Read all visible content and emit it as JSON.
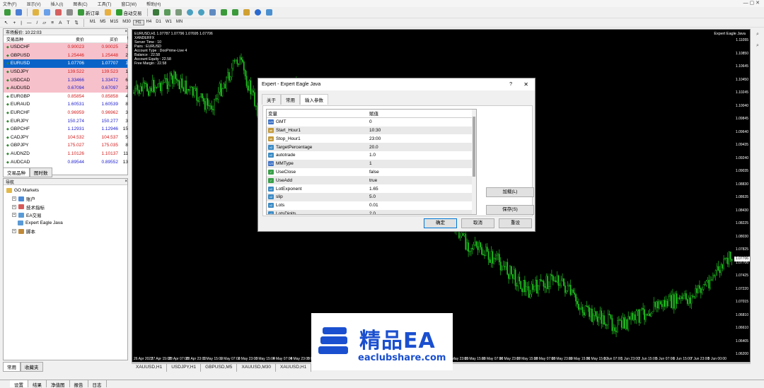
{
  "menu": [
    "文件(F)",
    "显示(V)",
    "插入(I)",
    "图表(C)",
    "工具(T)",
    "窗口(W)",
    "帮助(H)"
  ],
  "toolbar": {
    "new_order": "新订单",
    "auto_trade": "自动交易",
    "timeframes": [
      "M1",
      "M5",
      "M15",
      "M30",
      "H1",
      "H4",
      "D1",
      "W1",
      "MN"
    ],
    "active_timeframe": "H1"
  },
  "market_watch": {
    "title": "市场报价: 10:22:03",
    "col_symbol": "交易品种",
    "col_bid": "卖价",
    "col_ask": "买价",
    "col_spread": "!",
    "rows": [
      {
        "symbol": "USDCHF",
        "bid": "0.90023",
        "ask": "0.90025",
        "spread": "2",
        "style": "pink",
        "dir": "dn"
      },
      {
        "symbol": "GBPUSD",
        "bid": "1.25446",
        "ask": "1.25448",
        "spread": "2",
        "style": "pink",
        "dir": "dn"
      },
      {
        "symbol": "EURUSD",
        "bid": "1.07706",
        "ask": "1.07707",
        "spread": "1",
        "style": "sel",
        "dir": "up"
      },
      {
        "symbol": "USDJPY",
        "bid": "139.522",
        "ask": "139.523",
        "spread": "1",
        "style": "pink",
        "dir": "dn"
      },
      {
        "symbol": "USDCAD",
        "bid": "1.33466",
        "ask": "1.33472",
        "spread": "6",
        "style": "pink",
        "dir": "up"
      },
      {
        "symbol": "AUDUSD",
        "bid": "0.67094",
        "ask": "0.67097",
        "spread": "3",
        "style": "pink",
        "dir": "up"
      },
      {
        "symbol": "EURGBP",
        "bid": "0.85854",
        "ask": "0.85858",
        "spread": "4",
        "style": "",
        "dir": "dn"
      },
      {
        "symbol": "EURAUD",
        "bid": "1.60531",
        "ask": "1.60539",
        "spread": "8",
        "style": "",
        "dir": "up"
      },
      {
        "symbol": "EURCHF",
        "bid": "0.96959",
        "ask": "0.96962",
        "spread": "3",
        "style": "",
        "dir": "dn"
      },
      {
        "symbol": "EURJPY",
        "bid": "150.274",
        "ask": "150.277",
        "spread": "3",
        "style": "",
        "dir": "up"
      },
      {
        "symbol": "GBPCHF",
        "bid": "1.12931",
        "ask": "1.12946",
        "spread": "15",
        "style": "",
        "dir": "up"
      },
      {
        "symbol": "CADJPY",
        "bid": "104.532",
        "ask": "104.537",
        "spread": "5",
        "style": "",
        "dir": "dn"
      },
      {
        "symbol": "GBPJPY",
        "bid": "175.027",
        "ask": "175.035",
        "spread": "8",
        "style": "",
        "dir": "dn"
      },
      {
        "symbol": "AUDNZD",
        "bid": "1.10126",
        "ask": "1.10137",
        "spread": "11",
        "style": "",
        "dir": "dn"
      },
      {
        "symbol": "AUDCAD",
        "bid": "0.89544",
        "ask": "0.89552",
        "spread": "13",
        "style": "",
        "dir": "up"
      }
    ],
    "tabs": [
      "交易品种",
      "图时数"
    ]
  },
  "navigator": {
    "title": "导航",
    "items": [
      {
        "label": "GO Markets",
        "level": 0,
        "icon": "folder-icon"
      },
      {
        "label": "账户",
        "level": 1,
        "icon": "account-icon"
      },
      {
        "label": "技术指标",
        "level": 1,
        "icon": "indicator-icon"
      },
      {
        "label": "EA交易",
        "level": 1,
        "icon": "expert-icon"
      },
      {
        "label": "Expert Eagle Java",
        "level": 2,
        "icon": "expert-icon"
      },
      {
        "label": "脚本",
        "level": 1,
        "icon": "script-icon"
      }
    ],
    "tabs": [
      "常用",
      "收藏夹"
    ]
  },
  "chart": {
    "header": "EURUSD,H1  1.07787 1.07796 1.07695 1.07706",
    "info_lines": [
      "XANDERFX",
      "Server Time   : 10",
      "Pairs            : EURUSD",
      "Account Type  : DooPrime-Live 4",
      "Balance        : 22.58",
      "Account Equity  : 22.58",
      "Free Margin    : 22.58"
    ],
    "ea_label": "Expert Eagle Java",
    "price_ticks": [
      "1.11055",
      "1.10850",
      "1.10645",
      "1.10450",
      "1.10245",
      "1.10040",
      "1.09845",
      "1.09640",
      "1.09435",
      "1.09240",
      "1.09035",
      "1.08830",
      "1.08635",
      "1.08430",
      "1.08225",
      "1.08030",
      "1.07825",
      "1.07706",
      "1.07425",
      "1.07220",
      "1.07015",
      "1.06810",
      "1.06610",
      "1.06405",
      "1.06200"
    ],
    "current_price": "1.07706",
    "time_ticks": [
      "26 Apr 2023",
      "27 Apr 15:00",
      "28 Apr 07:00",
      "28 Apr 23:00",
      "1 May 15:00",
      "2 May 07:00",
      "2 May 23:00",
      "3 May 15:00",
      "4 May 07:00",
      "4 May 23:00",
      "5 May 15:00",
      "8 May 07:00",
      "8 May 23:00",
      "9 May 15:00",
      "10 May 07:00",
      "10 May 23:00",
      "11 May 15:00",
      "12 May 07:00",
      "12 May 23:00",
      "15 May 15:00",
      "16 May 07:00",
      "16 May 23:00",
      "17 May 15:00",
      "18 May 07:00",
      "18 May 23:00",
      "19 May 15:00",
      "31 May 15:00",
      "1 Jun 07:00",
      "1 Jun 23:00",
      "2 Jun 15:00",
      "5 Jun 07:00",
      "6 Jun 15:00",
      "7 Jun 23:00",
      "9 Jun 00:00"
    ],
    "tabs": [
      "XAUUSD,H1",
      "USDJPY,H1",
      "GBPUSD,M5",
      "XAUUSD,M30",
      "XAUUSD,H1"
    ]
  },
  "dialog": {
    "title": "Expert - Expert Eagle Java",
    "help": "?",
    "close": "✕",
    "tabs": [
      "关于",
      "常用",
      "输入参数"
    ],
    "active_tab": "输入参数",
    "col_var": "变量",
    "col_val": "赋值",
    "params": [
      {
        "name": "GMT",
        "value": "0",
        "type": "int"
      },
      {
        "name": "Start_Hour1",
        "value": "10:30",
        "type": "str"
      },
      {
        "name": "Stop_Hour1",
        "value": "23:00",
        "type": "str"
      },
      {
        "name": "TargetPercentage",
        "value": "20.0",
        "type": "dbl"
      },
      {
        "name": "autotrade",
        "value": "1.0",
        "type": "dbl"
      },
      {
        "name": "MMType",
        "value": "1",
        "type": "int"
      },
      {
        "name": "UseClose",
        "value": "false",
        "type": "bool"
      },
      {
        "name": "UseAdd",
        "value": "true",
        "type": "bool"
      },
      {
        "name": "LotExponent",
        "value": "1.65",
        "type": "dbl"
      },
      {
        "name": "slip",
        "value": "5.0",
        "type": "dbl"
      },
      {
        "name": "Lots",
        "value": "0.01",
        "type": "dbl"
      },
      {
        "name": "LotsDigits",
        "value": "2.0",
        "type": "dbl"
      }
    ],
    "load_button": "加载(L)",
    "save_button": "保存(S)",
    "ok_button": "确定",
    "cancel_button": "取消",
    "reset_button": "重设"
  },
  "terminal_tabs": [
    "设置",
    "结果",
    "净值图",
    "报告",
    "日志"
  ],
  "watermark": {
    "title": "精品EA",
    "url": "eaclubshare.com"
  },
  "colors": {
    "candle": "#1fbf1f",
    "selected_row": "#0a64c8",
    "pink_row": "#f7c1cb",
    "brand_blue": "#1a4fcf"
  }
}
